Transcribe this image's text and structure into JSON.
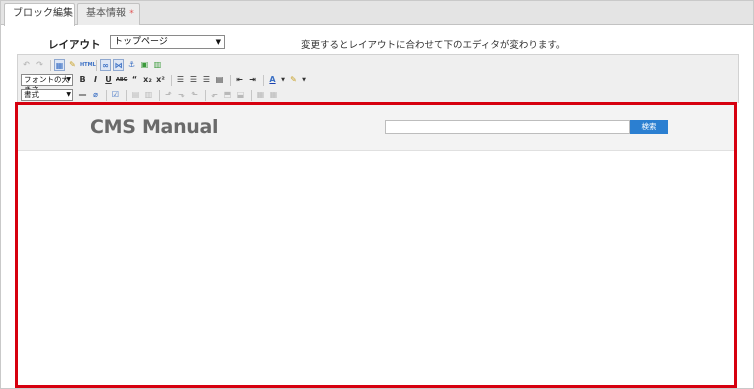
{
  "tabs": [
    {
      "label": "ブロック編集"
    },
    {
      "label": "基本情報",
      "marker": "*"
    }
  ],
  "layout": {
    "label": "レイアウト",
    "selected": "トップページ",
    "hint": "変更するとレイアウトに合わせて下のエディタが変わります。"
  },
  "toolbar": {
    "font_size_select": "フォントの大きさ",
    "format_select": "書式",
    "icons_row1": [
      "undo-icon",
      "redo-icon",
      "show-blocks-icon",
      "spellcheck-icon",
      "html-source-icon",
      "link-icon",
      "unlink-icon",
      "anchor-icon",
      "image-icon",
      "table-icon"
    ],
    "icons_row2": [
      "bold-icon",
      "italic-icon",
      "underline-icon",
      "strikethrough-icon",
      "blockquote-icon",
      "subscript-icon",
      "superscript-icon",
      "align-left-icon",
      "align-center-icon",
      "align-right-icon",
      "align-justify-icon",
      "outdent-icon",
      "indent-icon",
      "text-color-icon",
      "background-color-icon"
    ],
    "icons_row3": [
      "horizontal-rule-icon",
      "eraser-icon",
      "checkbox-icon",
      "insert-row-icon",
      "insert-col-icon",
      "delete-row-icon",
      "delete-col-icon",
      "merge-cell-icon",
      "split-cell-icon",
      "cell-props-icon",
      "table-props-icon"
    ],
    "labels": {
      "bold": "B",
      "italic": "I",
      "underline": "U",
      "strike": "ABC",
      "quote": "“",
      "sub": "x₂",
      "sup": "x²",
      "text_color": "A"
    }
  },
  "editor": {
    "site_title": "CMS Manual",
    "search_button": "検索",
    "highlight_color": "#d6000f",
    "search_button_color": "#2b7fd1"
  }
}
